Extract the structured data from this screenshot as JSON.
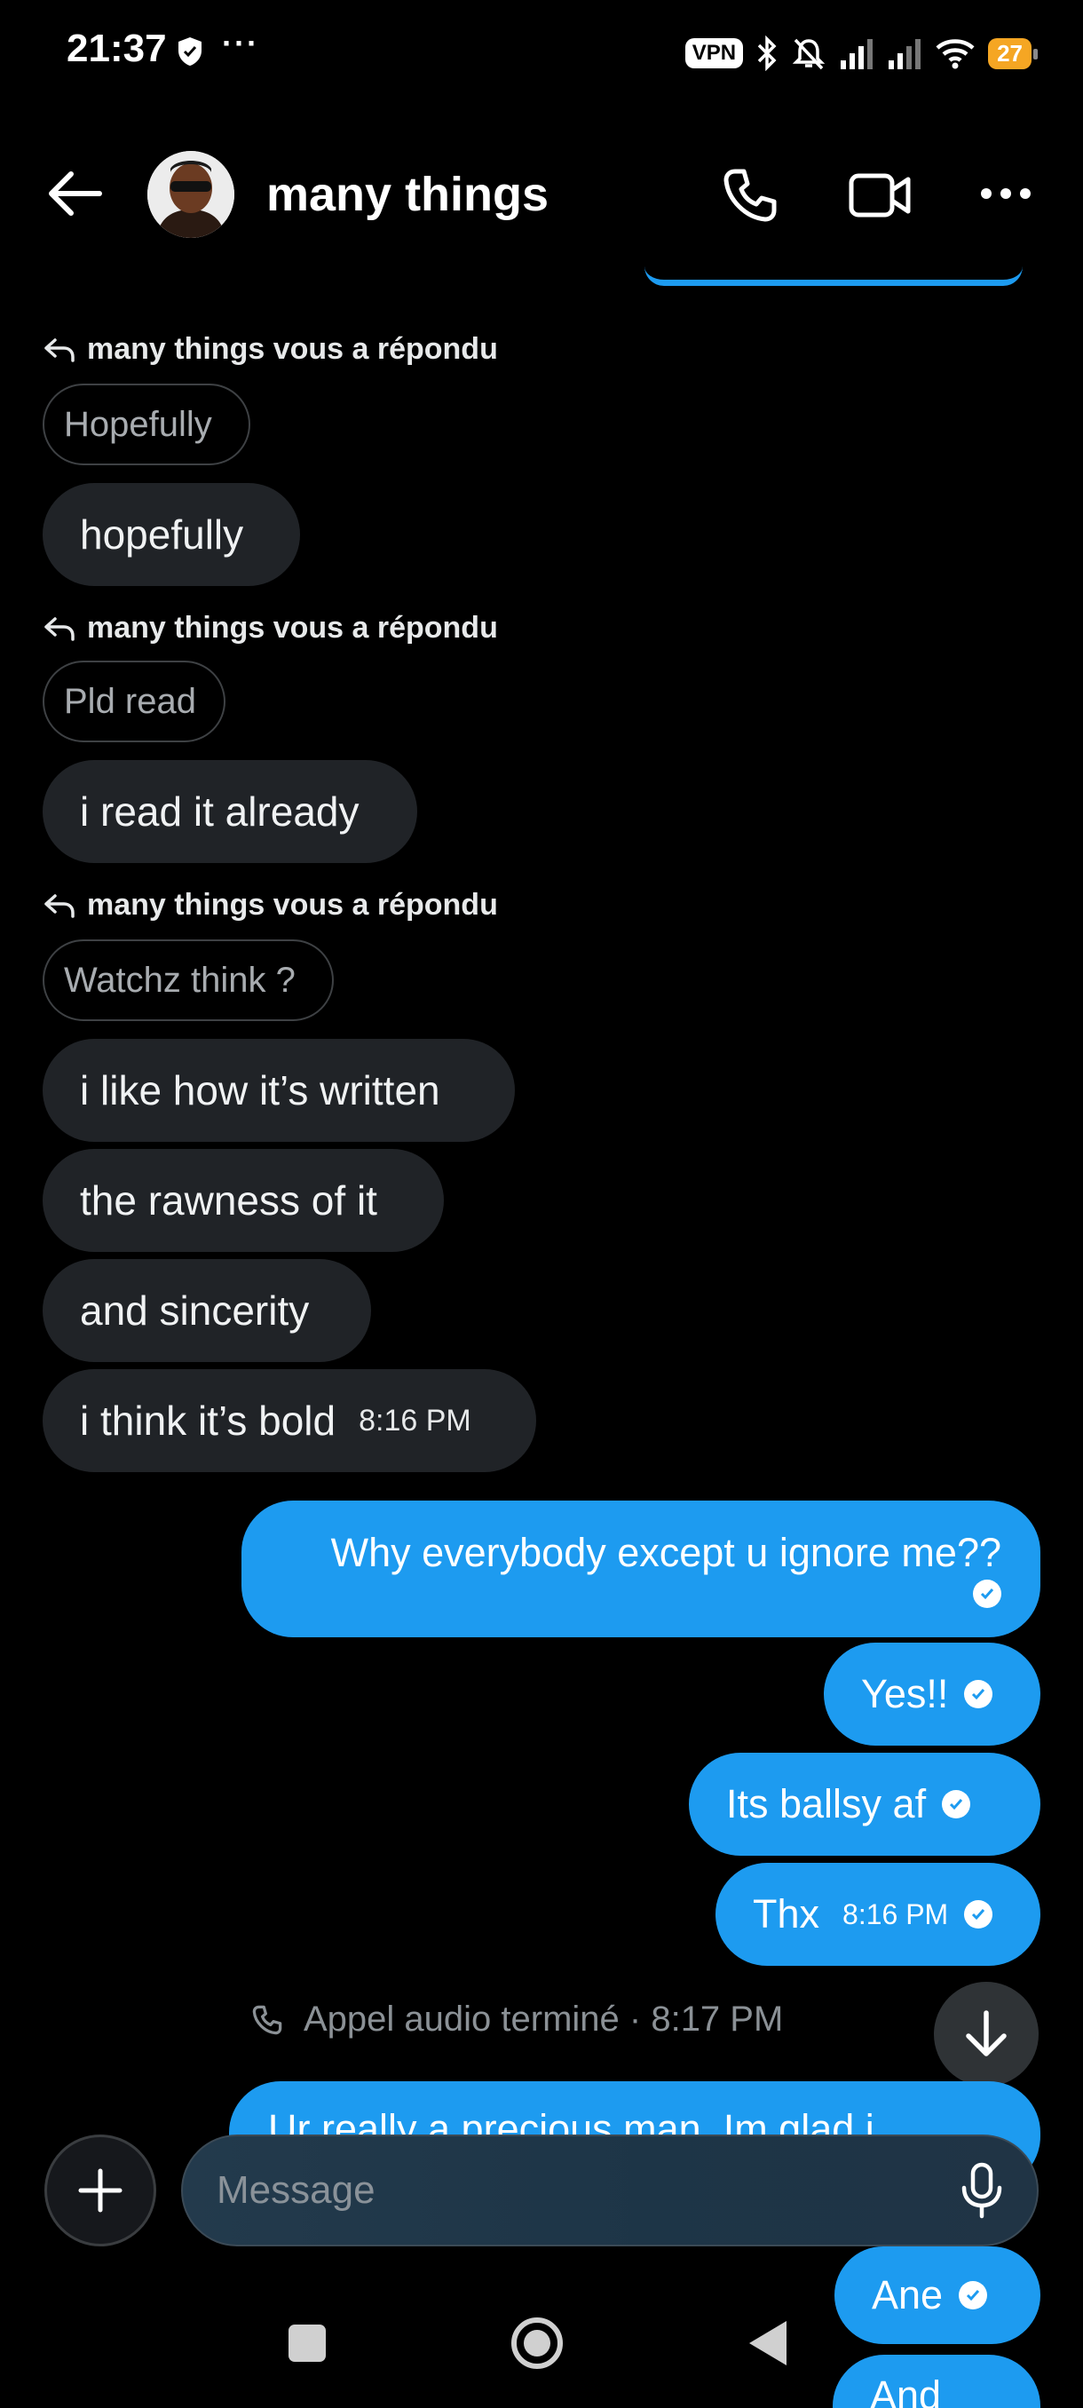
{
  "status_bar": {
    "time": "21:37",
    "dots": "···",
    "vpn": "VPN",
    "battery": "27"
  },
  "header": {
    "title": "many things"
  },
  "messages": {
    "reply_label": "many things vous a répondu",
    "quote_1": "Hopefully",
    "msg_1": "hopefully",
    "quote_2": "Pld read",
    "msg_2": "i read it already",
    "quote_3": "Watchz think ?",
    "msg_3": "i like how it’s written",
    "msg_4": "the rawness of it",
    "msg_5": "and sincerity",
    "msg_6": "i think it’s bold",
    "msg_6_time": "8:16 PM",
    "out_1": "Why everybody except u ignore me??",
    "out_2": "Yes!!",
    "out_3": "Its ballsy af",
    "out_4": "Thx",
    "out_4_time": "8:16 PM",
    "call_ended": "Appel audio terminé · 8:17 PM",
    "out_5_partial": "Ur really a precious man. Im glad i",
    "out_6": "Ane",
    "out_7_partial": "And"
  },
  "composer": {
    "placeholder": "Message"
  },
  "colors": {
    "outgoing_bubble": "#1d9bf0",
    "incoming_bubble": "#202327",
    "battery": "#f5a623"
  },
  "icons": [
    "back-arrow-icon",
    "phone-icon",
    "video-icon",
    "more-icon",
    "reply-icon",
    "check-icon",
    "arrow-down-icon",
    "plus-icon",
    "microphone-icon"
  ]
}
